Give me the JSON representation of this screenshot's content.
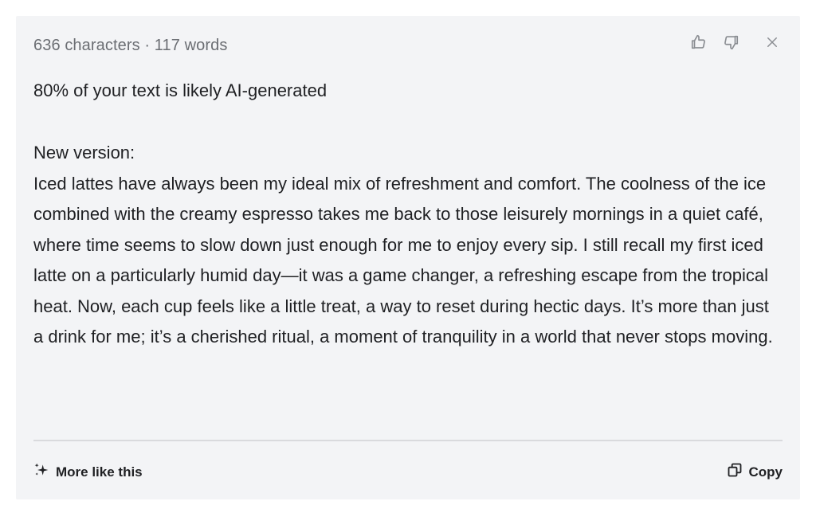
{
  "stats": {
    "text": "636 characters · 117 words"
  },
  "result": {
    "text": "80% of your text is likely AI-generated"
  },
  "new_version": {
    "label": "New version:",
    "body": "Iced lattes have always been my ideal mix of refreshment and comfort. The coolness of the ice combined with the creamy espresso takes me back to those leisurely mornings in a quiet café, where time seems to slow down just enough for me to enjoy every sip. I still recall my first iced latte on a particularly humid day—it was a game changer, a refreshing escape from the tropical heat. Now, each cup feels like a little treat, a way to reset during hectic days. It’s more than just a drink for me; it’s a cherished ritual, a moment of tranquility in a world that never stops moving."
  },
  "footer": {
    "more_label": "More like this",
    "copy_label": "Copy"
  },
  "icons": {
    "thumbs_up": "thumbs-up-icon",
    "thumbs_down": "thumbs-down-icon",
    "close": "close-icon",
    "sparkle": "sparkle-icon",
    "copy": "copy-icon"
  },
  "colors": {
    "card_background": "#f3f4f6",
    "text": "#1f2023",
    "muted": "#6b6e73",
    "divider": "#d9dadd"
  }
}
